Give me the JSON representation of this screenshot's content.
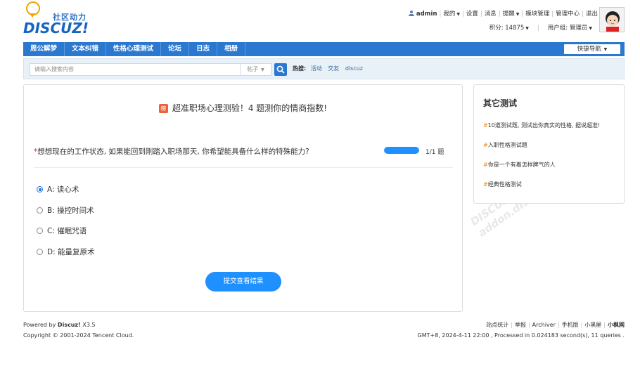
{
  "logo": {
    "slogan": "社区动力",
    "word": "DISCUZ!"
  },
  "topnav": {
    "user": "admin",
    "links": [
      "我的",
      "设置",
      "消息",
      "提醒",
      "模块管理",
      "管理中心",
      "退出"
    ],
    "points": "积分: 14875",
    "group": "用户组: 管理员"
  },
  "nav": {
    "items": [
      "周公解梦",
      "文本纠错",
      "性格心理测试",
      "论坛",
      "日志",
      "相册"
    ],
    "quick": "快捷导航"
  },
  "search": {
    "placeholder": "请输入搜索内容",
    "type": "帖子",
    "hot_label": "热搜:",
    "hot_words": [
      "活动",
      "交友",
      "discuz"
    ]
  },
  "quiz": {
    "badge": "榜",
    "title": "超准职场心理测验！4 题测你的情商指数!",
    "required_mark": "*",
    "question": "想想现在的工作状态, 如果能回到刚踏入职场那天, 你希望能具备什么样的特殊能力?",
    "progress": 1.0,
    "progress_text": "1/1 题",
    "options": [
      {
        "label": "A:  读心术",
        "selected": true
      },
      {
        "label": "B:  操控时间术",
        "selected": false
      },
      {
        "label": "C:  催眠咒语",
        "selected": false
      },
      {
        "label": "D:  能量复原术",
        "selected": false
      }
    ],
    "submit": "提交查看结果"
  },
  "side": {
    "title": "其它测试",
    "hash": "#",
    "links": [
      "10道测试题, 测试出你真实的性格, 据说超准!",
      "入职性格测试题",
      "你是一个有着怎样脾气的人",
      "经典性格测试"
    ]
  },
  "watermark": {
    "brand": "DISCUZ!应用中心丨贰道",
    "domain": "addon.dismall.com"
  },
  "footer": {
    "powered_prefix": "Powered by ",
    "powered_name": "Discuz!",
    "powered_version": " X3.5",
    "copyright": "Copyright © 2001-2024 Tencent Cloud.",
    "links": [
      "站点统计",
      "举报",
      "Archiver",
      "手机版",
      "小黑屋"
    ],
    "site": "小枫网",
    "stats": "GMT+8, 2024-4-11 22:00 , Processed in 0.024183 second(s), 11 queries ."
  },
  "colors": {
    "primary": "#2a78d0",
    "button": "#1e90ff",
    "hash": "#f08300"
  }
}
